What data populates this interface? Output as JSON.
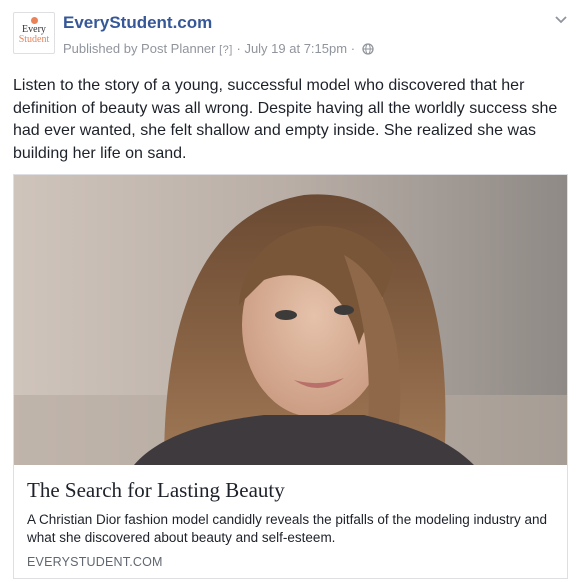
{
  "header": {
    "logo_line1": "Every",
    "logo_line2": "Student",
    "page_name": "EveryStudent.com",
    "published_by": "Published by Post Planner",
    "help_marker": "[?]",
    "timestamp": "July 19 at 7:15pm",
    "separator": "·",
    "privacy_icon": "globe-icon",
    "menu_icon": "chevron-down-icon"
  },
  "post": {
    "text": "Listen to the story of a young, successful model who discovered that her definition of beauty was all wrong. Despite having all the worldly success she had ever wanted, she felt shallow and empty inside. She realized she was building her life on sand."
  },
  "link_card": {
    "title": "The Search for Lasting Beauty",
    "description": "A Christian Dior fashion model candidly reveals the pitfalls of the modeling industry and what she discovered about beauty and self-esteem.",
    "domain": "EVERYSTUDENT.COM"
  },
  "colors": {
    "link_blue": "#365899",
    "meta_gray": "#90949c",
    "logo_accent": "#e9835a"
  }
}
